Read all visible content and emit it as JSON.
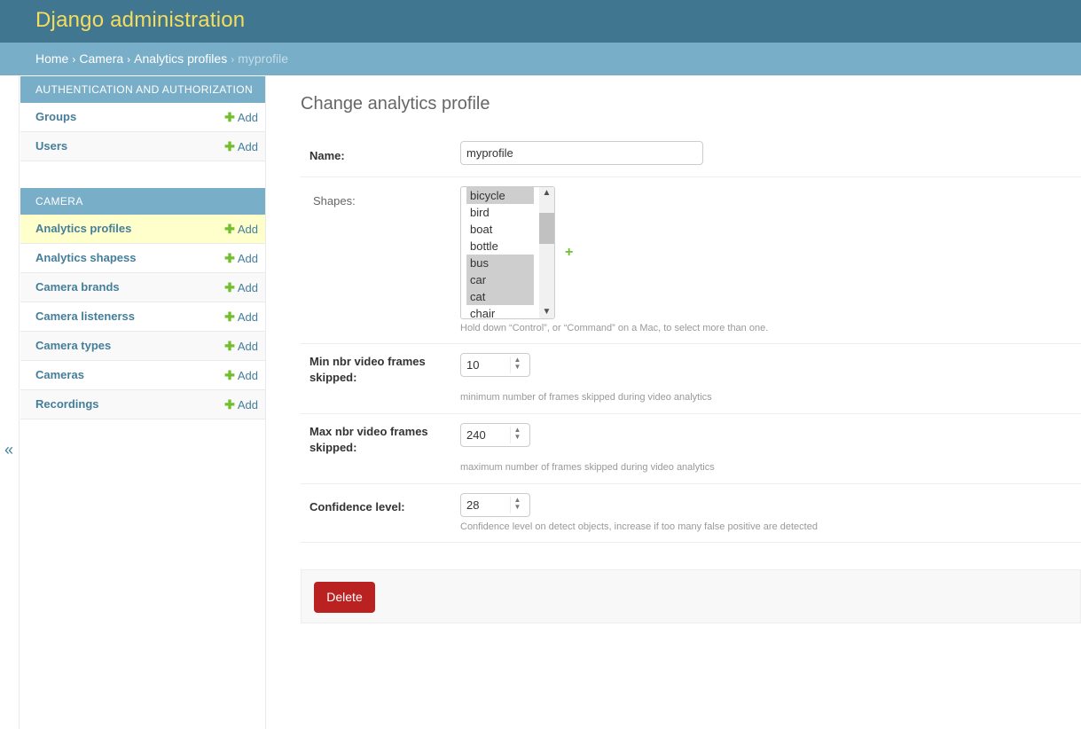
{
  "header": {
    "site_name": "Django administration"
  },
  "breadcrumbs": {
    "home": "Home",
    "app": "Camera",
    "model": "Analytics profiles",
    "current": "myprofile",
    "separator": "›"
  },
  "sidebar": {
    "toggle": "«",
    "modules": [
      {
        "caption": "Authentication and Authorization",
        "models": [
          {
            "name": "Groups",
            "add": "Add"
          },
          {
            "name": "Users",
            "add": "Add"
          }
        ]
      },
      {
        "caption": "Camera",
        "models": [
          {
            "name": "Analytics profiles",
            "add": "Add"
          },
          {
            "name": "Analytics shapess",
            "add": "Add"
          },
          {
            "name": "Camera brands",
            "add": "Add"
          },
          {
            "name": "Camera listenerss",
            "add": "Add"
          },
          {
            "name": "Camera types",
            "add": "Add"
          },
          {
            "name": "Cameras",
            "add": "Add"
          },
          {
            "name": "Recordings",
            "add": "Add"
          }
        ]
      }
    ]
  },
  "main": {
    "title": "Change analytics profile",
    "name_field": {
      "label": "Name:",
      "value": "myprofile"
    },
    "shapes_field": {
      "label": "Shapes:",
      "options": [
        {
          "label": "bicycle",
          "selected": true
        },
        {
          "label": "bird",
          "selected": false
        },
        {
          "label": "boat",
          "selected": false
        },
        {
          "label": "bottle",
          "selected": false
        },
        {
          "label": "bus",
          "selected": true
        },
        {
          "label": "car",
          "selected": true
        },
        {
          "label": "cat",
          "selected": true
        },
        {
          "label": "chair",
          "selected": false
        }
      ],
      "add_icon": "+",
      "help": "Hold down “Control”, or “Command” on a Mac, to select more than one."
    },
    "min_frames": {
      "label": "Min nbr video frames skipped:",
      "value": "10",
      "help": "minimum number of frames skipped during video analytics"
    },
    "max_frames": {
      "label": "Max nbr video frames skipped:",
      "value": "240",
      "help": "maximum number of frames skipped during video analytics"
    },
    "confidence": {
      "label": "Confidence level:",
      "value": "28",
      "help": "Confidence level on detect objects, increase if too many false positive are detected"
    },
    "delete_label": "Delete"
  },
  "colors": {
    "header": "#417690",
    "breadcrumbs": "#79aec8",
    "site_name": "#f5dd5d",
    "link": "#447e9b",
    "add_plus": "#70bf2b",
    "delete": "#ba2121",
    "current_row": "#ffffcc"
  }
}
